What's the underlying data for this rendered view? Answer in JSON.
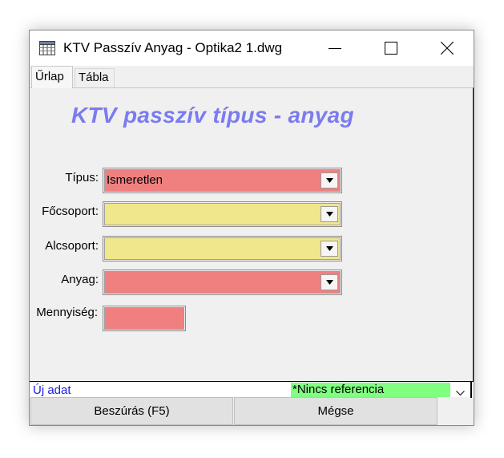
{
  "window": {
    "title": "KTV Passzív Anyag - Optika2 1.dwg"
  },
  "tabs": [
    {
      "label": "Űrlap",
      "active": true
    },
    {
      "label": "Tábla",
      "active": false
    }
  ],
  "form": {
    "heading": "KTV passzív típus - anyag",
    "fields": {
      "tipus": {
        "label": "Típus:",
        "value": "Ismeretlen",
        "color": "#f08080"
      },
      "focsoport": {
        "label": "Főcsoport:",
        "value": "",
        "color": "#f0e68c"
      },
      "alcsoport": {
        "label": "Alcsoport:",
        "value": "",
        "color": "#f0e68c"
      },
      "anyag": {
        "label": "Anyag:",
        "value": "",
        "color": "#f08080"
      },
      "mennyiseg": {
        "label": "Mennyiség:",
        "value": "",
        "color": "#f08080"
      }
    }
  },
  "status": {
    "left_text": "Új adat",
    "reference_text": "*Nincs referencia",
    "reference_color": "#80ff80",
    "left_text_color": "#1a1adb"
  },
  "buttons": {
    "insert_label": "Beszúrás (F5)",
    "cancel_label": "Mégse"
  },
  "icons": {
    "app": "table-icon",
    "minimize": "minimize-icon",
    "maximize": "maximize-icon",
    "close": "close-icon",
    "dropdown": "dropdown-arrow-icon",
    "status_dropdown": "chevron-down-icon"
  }
}
